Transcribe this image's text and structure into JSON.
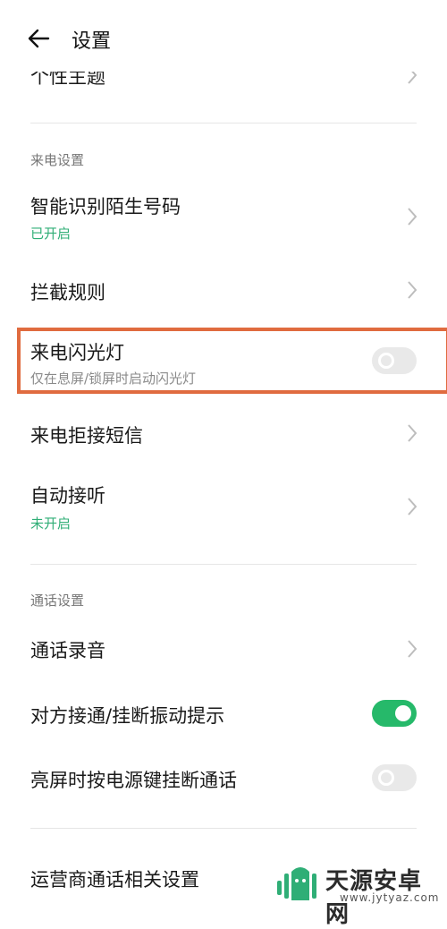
{
  "header": {
    "title": "设置"
  },
  "top_item": {
    "label": "个性主题"
  },
  "sections": {
    "call": "来电设置",
    "talk": "通话设置"
  },
  "items": {
    "smart_id": {
      "label": "智能识别陌生号码",
      "status": "已开启"
    },
    "block_rules": {
      "label": "拦截规则"
    },
    "flash": {
      "label": "来电闪光灯",
      "desc": "仅在息屏/锁屏时启动闪光灯",
      "toggle_on": false
    },
    "reject_sms": {
      "label": "来电拒接短信"
    },
    "auto_answer": {
      "label": "自动接听",
      "status": "未开启"
    },
    "recording": {
      "label": "通话录音"
    },
    "vibrate": {
      "label": "对方接通/挂断振动提示",
      "toggle_on": true
    },
    "power_hangup": {
      "label": "亮屏时按电源键挂断通话",
      "toggle_on": false
    },
    "carrier": {
      "label": "运营商通话相关设置"
    }
  },
  "watermark": {
    "name": "天源安卓网",
    "url": "www.jytyaz.com"
  },
  "colors": {
    "accent_green": "#26b96a",
    "status_green": "#2fae76",
    "highlight": "#e06b3f"
  }
}
